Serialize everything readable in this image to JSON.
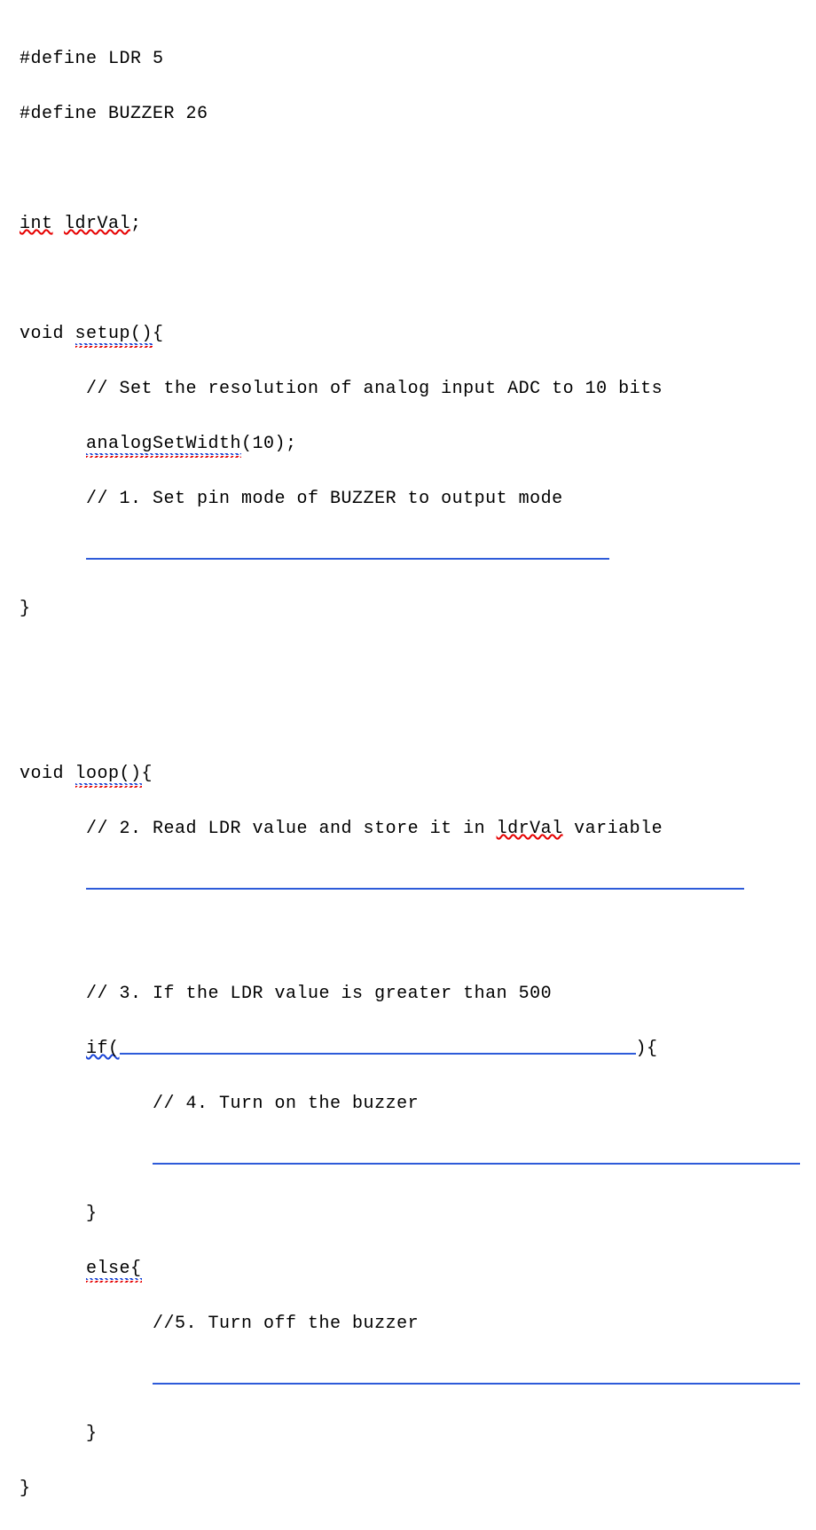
{
  "code": {
    "l1a": "#define LDR 5",
    "l2a": "#define BUZZER 26",
    "l4_int": "int",
    "l4_var": "ldrVal",
    "l4_end": ";",
    "l6_void": "void ",
    "l6_setup": "setup()",
    "l6_end": "{",
    "l7": "      // Set the resolution of analog input ADC to 10 bits",
    "l8_indent": "      ",
    "l8_fn": "analogSetWidth",
    "l8_end": "(10);",
    "l9": "      // 1. Set pin mode of BUZZER to output mode",
    "l10_indent": "      ",
    "l11": "}",
    "l14_void": "void ",
    "l14_loop": "loop()",
    "l14_end": "{",
    "l15a": "      // 2. Read LDR value and store it in ",
    "l15b": "ldrVal",
    "l15c": " variable",
    "l16_indent": "      ",
    "l18": "      // 3. If the LDR value is greater than 500",
    "l19_indent": "      ",
    "l19_if": "if(",
    "l19_end": "){",
    "l20": "            // 4. Turn on the buzzer",
    "l21_indent": "            ",
    "l22": "      }",
    "l23_indent": "      ",
    "l23_else": "else{",
    "l24": "            //5. Turn off the buzzer",
    "l25_indent": "            ",
    "l26": "      }",
    "l27": "}"
  }
}
